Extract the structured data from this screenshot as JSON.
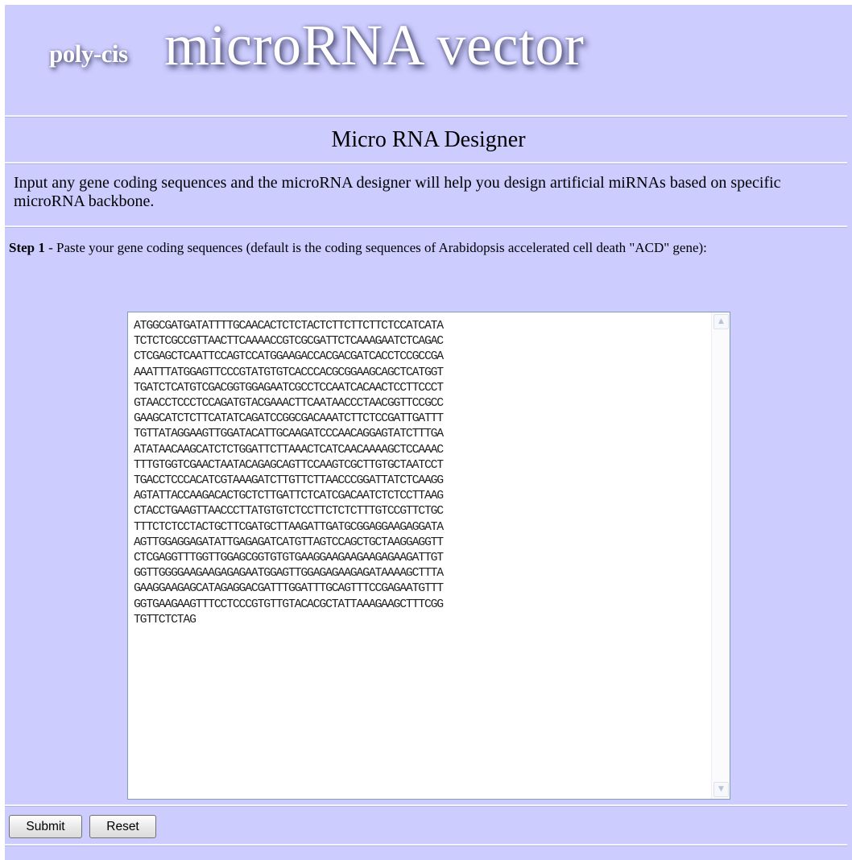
{
  "banner": {
    "logo_small": "poly-cis",
    "logo_big": "microRNA vector"
  },
  "page_title": "Micro RNA Designer",
  "intro_text": "Input any gene coding sequences and the microRNA designer will help you design artificial miRNAs based on specific microRNA backbone.",
  "step1": {
    "label": "Step 1",
    "text": " - Paste your gene coding sequences (default is the coding sequences of Arabidopsis accelerated cell death \"ACD\" gene):"
  },
  "sequence_input": {
    "value": "ATGGCGATGATATTTTGCAACACTCTCTACTCTTCTTCTTCTCCATCATA\nTCTCTCGCCGTTAACTTCAAAACCGTCGCGATTCTCAAAGAATCTCAGAC\nCTCGAGCTCAATTCCAGTCCATGGAAGACCACGACGATCACCTCCGCCGA\nAAATTTATGGAGTTCCCGTATGTGTCACCCACGCGGAAGCAGCTCATGGT\nTGATCTCATGTCGACGGTGGAGAATCGCCTCCAATCACAACTCCTTCCCT\nGTAACCTCCCTCCAGATGTACGAAACTTCAATAACCCTAACGGTTCCGCC\nGAAGCATCTCTTCATATCAGATCCGGCGACAAATCTTCTCCGATTGATTT\nTGTTATAGGAAGTTGGATACATTGCAAGATCCCAACAGGAGTATCTTTGA\nATATAACAAGCATCTCTGGATTCTTAAACTCATCAACAAAAGCTCCAAAC\nTTTGTGGTCGAACTAATACAGAGCAGTTCCAAGTCGCTTGTGCTAATCCT\nTGACCTCCCACATCGTAAAGATCTTGTTCTTAACCCGGATTATCTCAAGG\nAGTATTACCAAGACACTGCTCTTGATTCTCATCGACAATCTCTCCTTAAG\nCTACCTGAAGTTAACCCTTATGTGTCTCCTTCTCTCTTTGTCCGTTCTGC\nTTTCTCTCCTACTGCTTCGATGCTTAAGATTGATGCGGAGGAAGAGGATA\nAGTTGGAGGAGATATTGAGAGATCATGTTAGTCCAGCTGCTAAGGAGGTT\nCTCGAGGTTTGGTTGGAGCGGTGTGTGAAGGAAGAAGAAGAGAAGATTGT\nGGTTGGGGAAGAAGAGAGAATGGAGTTGGAGAGAAGAGATAAAAGCTTTA\nGAAGGAAGAGCATAGAGGACGATTTGGATTTGCAGTTTCCGAGAATGTTT\nGGTGAAGAAGTTTCCTCCCGTGTTGTACACGCTATTAAAGAAGCTTTCGG\nTGTTCTCTAG"
  },
  "buttons": {
    "submit": "Submit",
    "reset": "Reset"
  },
  "colors": {
    "page_background": "#ccccff",
    "rule": "#f4f4ff"
  },
  "icons": {
    "scroll_up": "scroll-up-arrow-icon",
    "scroll_down": "scroll-down-arrow-icon"
  }
}
